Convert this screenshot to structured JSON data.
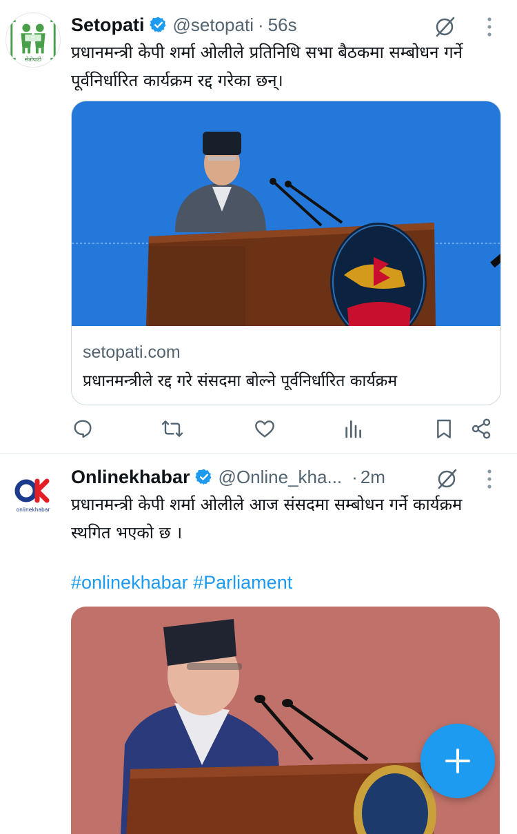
{
  "tweets": [
    {
      "name": "Setopati",
      "handle": "@setopati",
      "time": "56s",
      "avatar_text": "सेतोपाटी",
      "text": "प्रधानमन्त्री केपी शर्मा ओलीले प्रतिनिधि सभा बैठकमा सम्बोधन गर्ने पूर्वनिर्धारित कार्यक्रम रद्द गरेका छन्।",
      "card": {
        "domain": "setopati.com",
        "title": "प्रधानमन्त्रीले रद्द गरे संसदमा बोल्ने पूर्वनिर्धारित कार्यक्रम"
      }
    },
    {
      "name": "Onlinekhabar",
      "handle": "@Online_kha...",
      "time": "2m",
      "avatar_text": "onlinekhabar",
      "text": "प्रधानमन्त्री केपी शर्मा ओलीले आज संसदमा सम्बोधन गर्ने कार्यक्रम स्थगित भएको छ ।",
      "hashtags": "#onlinekhabar #Parliament"
    }
  ],
  "separator": "·",
  "actions": [
    "reply-icon",
    "retweet-icon",
    "like-icon",
    "views-icon",
    "bookmark-icon",
    "share-icon"
  ],
  "colors": {
    "accent": "#1d9bf0",
    "secondary_text": "#536471",
    "primary_text": "#0f1419"
  }
}
